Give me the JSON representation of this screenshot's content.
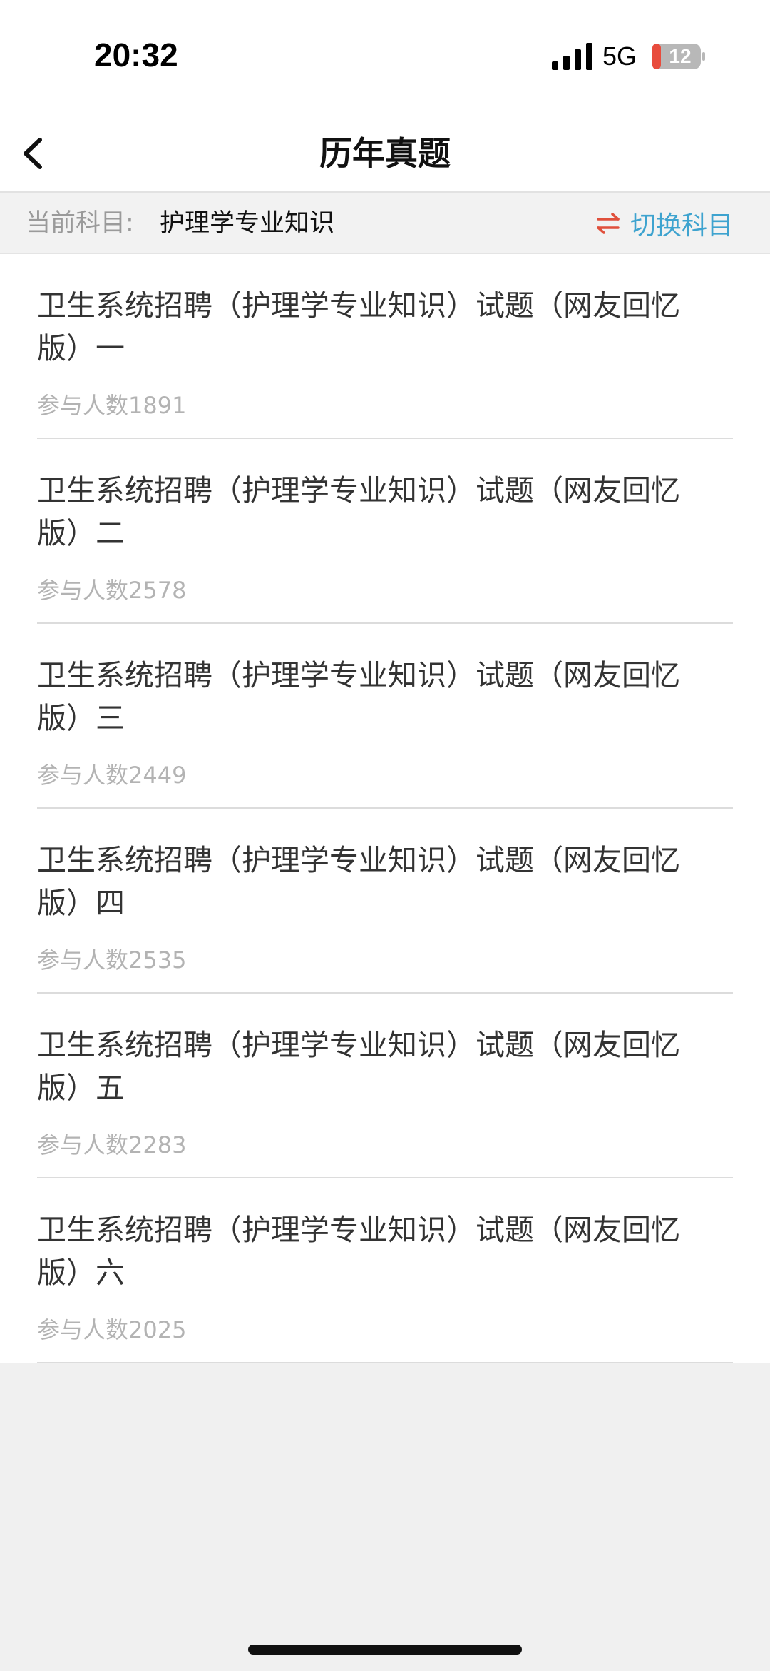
{
  "status_bar": {
    "time": "20:32",
    "network": "5G",
    "battery": "12"
  },
  "nav": {
    "title": "历年真题",
    "back_icon": "chevron-left-icon"
  },
  "subject_bar": {
    "label": "当前科目:",
    "value": "护理学专业知识",
    "switch_label": "切换科目",
    "switch_icon": "swap-arrows-icon",
    "colors": {
      "switch_icon": "#e0503c",
      "switch_label": "#3ea3cf"
    }
  },
  "exams": [
    {
      "title": "卫生系统招聘（护理学专业知识）试题（网友回忆版）一",
      "participants": "参与人数1891"
    },
    {
      "title": "卫生系统招聘（护理学专业知识）试题（网友回忆版）二",
      "participants": "参与人数2578"
    },
    {
      "title": "卫生系统招聘（护理学专业知识）试题（网友回忆版）三",
      "participants": "参与人数2449"
    },
    {
      "title": "卫生系统招聘（护理学专业知识）试题（网友回忆版）四",
      "participants": "参与人数2535"
    },
    {
      "title": "卫生系统招聘（护理学专业知识）试题（网友回忆版）五",
      "participants": "参与人数2283"
    },
    {
      "title": "卫生系统招聘（护理学专业知识）试题（网友回忆版）六",
      "participants": "参与人数2025"
    }
  ]
}
